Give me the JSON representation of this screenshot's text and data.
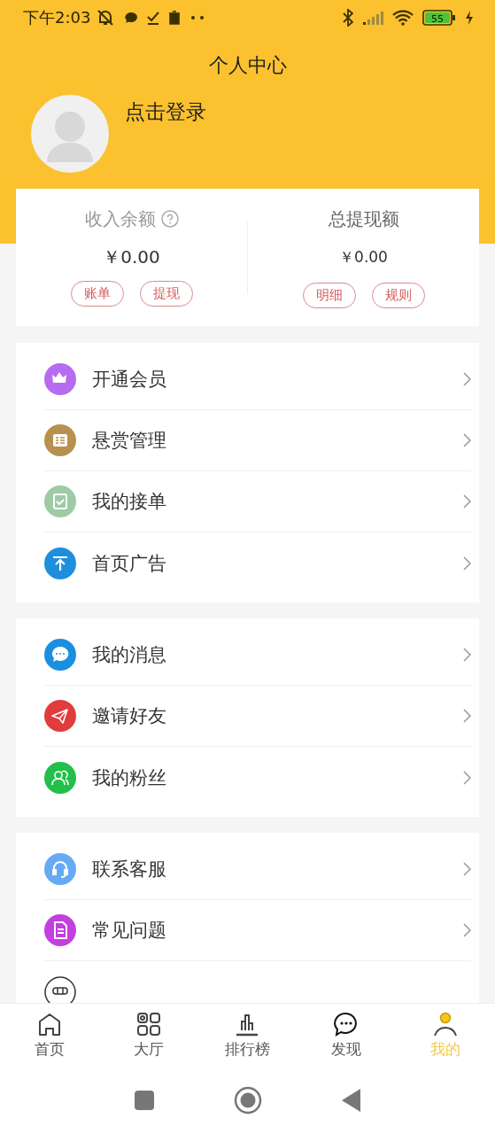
{
  "status_bar": {
    "time": "下午2:03",
    "battery": "55"
  },
  "header": {
    "title": "个人中心",
    "login": "点击登录"
  },
  "balance_card": {
    "columns": [
      {
        "label": "收入余额",
        "help": true,
        "amount": "￥0.00",
        "buttons": [
          "账单",
          "提现"
        ]
      },
      {
        "label": "总提现额",
        "help": false,
        "amount": "￥0.00",
        "buttons": [
          "明细",
          "规则"
        ]
      }
    ]
  },
  "menu_groups": [
    {
      "items": [
        "开通会员",
        "悬赏管理",
        "我的接单",
        "首页广告"
      ]
    },
    {
      "items": [
        "我的消息",
        "邀请好友",
        "我的粉丝"
      ]
    },
    {
      "items": [
        "联系客服",
        "常见问题"
      ]
    }
  ],
  "tab_bar": [
    {
      "label": "首页",
      "selected": false
    },
    {
      "label": "大厅",
      "selected": false
    },
    {
      "label": "排行榜",
      "selected": false
    },
    {
      "label": "发现",
      "selected": false
    },
    {
      "label": "我的",
      "selected": true
    }
  ]
}
